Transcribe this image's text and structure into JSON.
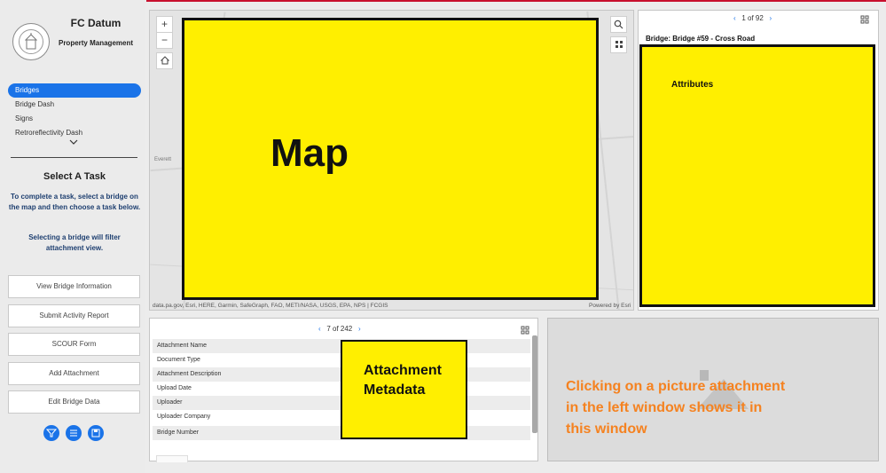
{
  "header": {
    "app_title": "FC Datum",
    "app_subtitle": "Property Management"
  },
  "nav": {
    "items": [
      "Bridges",
      "Bridge Dash",
      "Signs",
      "Retroreflectivity Dash"
    ],
    "active_index": 0
  },
  "task": {
    "title": "Select A Task",
    "description": "To complete a task, select a bridge on the map and then choose a task below.",
    "note": "Selecting a bridge will filter attachment view."
  },
  "actions": {
    "buttons": [
      "View Bridge Information",
      "Submit Activity Report",
      "SCOUR Form",
      "Add Attachment",
      "Edit Bridge Data"
    ]
  },
  "map": {
    "overlay_label": "Map",
    "zoom_in": "+",
    "zoom_out": "−",
    "attribution": "data.pa.gov, Esri, HERE, Garmin, SafeGraph, FAO, METI/NASA, USGS, EPA, NPS | FCGIS",
    "powered_by": "Powered by Esri",
    "place_labels": [
      "Everett"
    ]
  },
  "feature": {
    "pager_text": "1 of 92",
    "title": "Bridge: Bridge #59 - Cross Road",
    "overlay_label": "Attributes"
  },
  "attachments": {
    "pager_text": "7 of 242",
    "fields": [
      "Attachment Name",
      "Document Type",
      "Attachment Description",
      "Upload Date",
      "Uploader",
      "Uploader Company",
      "Bridge Number"
    ],
    "overlay_label_line1": "Attachment",
    "overlay_label_line2": "Metadata"
  },
  "preview": {
    "message": "Clicking on a picture attachment in the left window shows it in this window"
  },
  "colors": {
    "accent": "#1a73e8",
    "highlight_yellow": "#ffef00",
    "preview_text": "#f58220",
    "top_line": "#c8102e"
  }
}
